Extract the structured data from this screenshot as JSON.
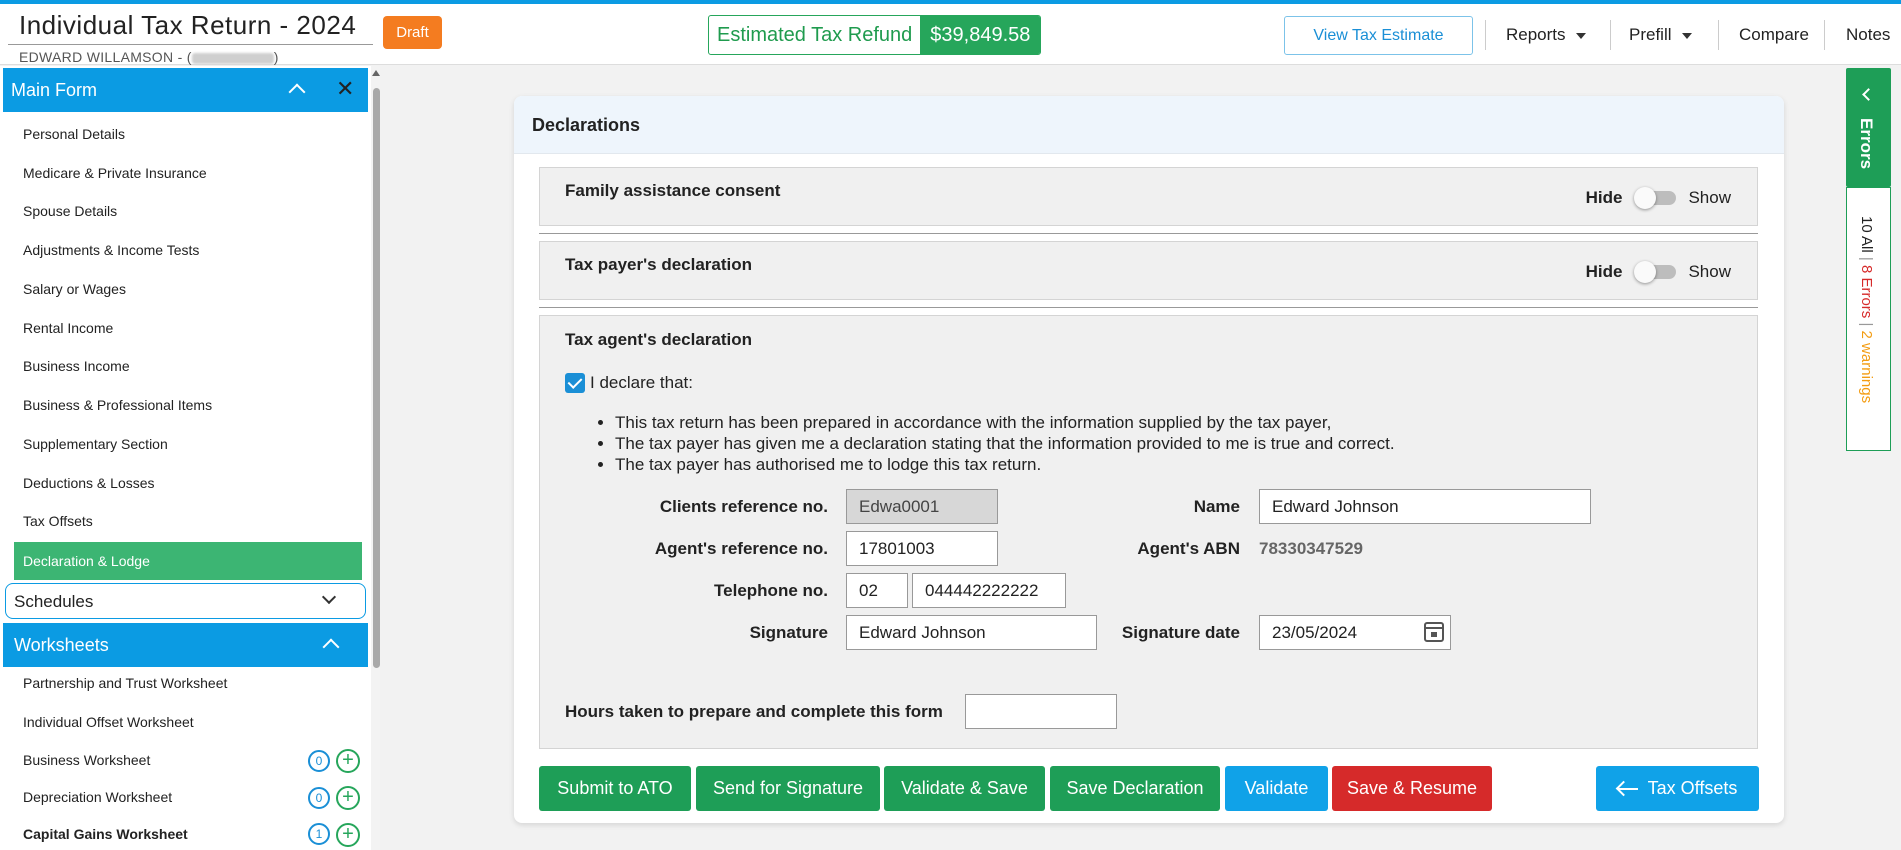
{
  "header": {
    "title": "Individual Tax Return - 2024",
    "client_name": "EDWARD WILLAMSON - (",
    "client_name_close": ")",
    "status_badge": "Draft",
    "refund_label": "Estimated Tax Refund",
    "refund_value": "$39,849.58",
    "view_estimate": "View Tax Estimate",
    "nav": [
      "Reports",
      "Prefill",
      "Compare",
      "Notes"
    ]
  },
  "sidebar": {
    "main_form": {
      "label": "Main Form",
      "items": [
        "Personal Details",
        "Medicare & Private Insurance",
        "Spouse Details",
        "Adjustments & Income Tests",
        "Salary or Wages",
        "Rental Income",
        "Business Income",
        "Business & Professional Items",
        "Supplementary Section",
        "Deductions & Losses",
        "Tax Offsets"
      ],
      "active_item": "Declaration & Lodge"
    },
    "schedules_label": "Schedules",
    "worksheets": {
      "label": "Worksheets",
      "items": [
        {
          "label": "Partnership and Trust Worksheet"
        },
        {
          "label": "Individual Offset Worksheet"
        },
        {
          "label": "Business Worksheet",
          "count": "0"
        },
        {
          "label": "Depreciation Worksheet",
          "count": "0"
        },
        {
          "label": "Capital Gains Worksheet",
          "count": "1"
        }
      ],
      "add_symbol": "+"
    }
  },
  "main": {
    "title": "Declarations",
    "panels": {
      "family_consent": "Family assistance consent",
      "taxpayer_declaration": "Tax payer's declaration",
      "agent_declaration": "Tax agent's declaration"
    },
    "toggle": {
      "hide": "Hide",
      "show": "Show"
    },
    "declare_label": "I declare that:",
    "bullets": [
      "This tax return has been prepared in accordance with the information supplied by the tax payer,",
      "The tax payer has given me a declaration stating that the information provided to me is true and correct.",
      "The tax payer has authorised me to lodge this tax return."
    ],
    "fields": {
      "client_ref_label": "Clients reference no.",
      "client_ref_value": "Edwa0001",
      "agent_ref_label": "Agent's reference no.",
      "agent_ref_value": "17801003",
      "telephone_label": "Telephone no.",
      "telephone_area": "02",
      "telephone_number": "044442222222",
      "signature_label": "Signature",
      "signature_value": "Edward Johnson",
      "name_label": "Name",
      "name_value": "Edward Johnson",
      "abn_label": "Agent's ABN",
      "abn_value": "78330347529",
      "signature_date_label": "Signature date",
      "signature_date_value": "23/05/2024",
      "hours_label": "Hours taken to prepare and complete this form",
      "hours_value": ""
    },
    "buttons": {
      "submit": "Submit to ATO",
      "send_signature": "Send for Signature",
      "validate_save": "Validate & Save",
      "save_declaration": "Save Declaration",
      "validate": "Validate",
      "save_resume": "Save & Resume",
      "tax_offsets": "Tax Offsets"
    }
  },
  "errors_panel": {
    "tab_label": "Errors",
    "all": "10 All",
    "errors": "8 Errors",
    "warnings": "2 warnings",
    "separator": "|"
  },
  "colors": {
    "accent_blue": "#0b9be3",
    "green": "#1e9e57",
    "red": "#d62a2a",
    "orange": "#f47c20"
  }
}
